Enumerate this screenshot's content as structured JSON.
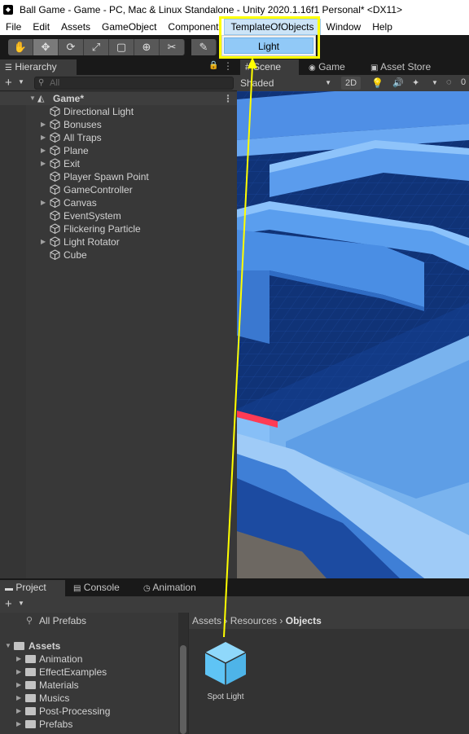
{
  "window": {
    "title": "Ball Game - Game - PC, Mac & Linux Standalone - Unity 2020.1.16f1 Personal* <DX11>"
  },
  "menu": {
    "items": [
      "File",
      "Edit",
      "Assets",
      "GameObject",
      "Component",
      "TemplateOfObjects",
      "Window",
      "Help"
    ],
    "active": "TemplateOfObjects",
    "dropdown_items": [
      "Light"
    ]
  },
  "hierarchy": {
    "tab": "Hierarchy",
    "search_placeholder": "All",
    "scene_name": "Game*",
    "items": [
      {
        "label": "Directional Light",
        "expandable": false
      },
      {
        "label": "Bonuses",
        "expandable": true
      },
      {
        "label": "All Traps",
        "expandable": true
      },
      {
        "label": "Plane",
        "expandable": true
      },
      {
        "label": "Exit",
        "expandable": true
      },
      {
        "label": "Player Spawn Point",
        "expandable": false
      },
      {
        "label": "GameController",
        "expandable": false
      },
      {
        "label": "Canvas",
        "expandable": true
      },
      {
        "label": "EventSystem",
        "expandable": false
      },
      {
        "label": "Flickering Particle",
        "expandable": false
      },
      {
        "label": "Light Rotator",
        "expandable": true
      },
      {
        "label": "Cube",
        "expandable": false
      }
    ]
  },
  "scene": {
    "tabs": [
      "Scene",
      "Game",
      "Asset Store"
    ],
    "shading_mode": "Shaded",
    "toggle_2d": "2D",
    "hidden_count": "0"
  },
  "project": {
    "tabs": [
      "Project",
      "Console",
      "Animation"
    ],
    "favorites_item": "All Prefabs",
    "tree_root": "Assets",
    "tree_items": [
      "Animation",
      "EffectExamples",
      "Materials",
      "Musics",
      "Post-Processing",
      "Prefabs"
    ],
    "breadcrumb": [
      "Assets",
      "Resources",
      "Objects"
    ],
    "asset_label": "Spot Light"
  },
  "colors": {
    "highlight": "#ffff00",
    "menu_active_bg": "#cce4f7",
    "dropdown_item_bg": "#91c9f7",
    "asset_cube": "#5fc4f5"
  }
}
